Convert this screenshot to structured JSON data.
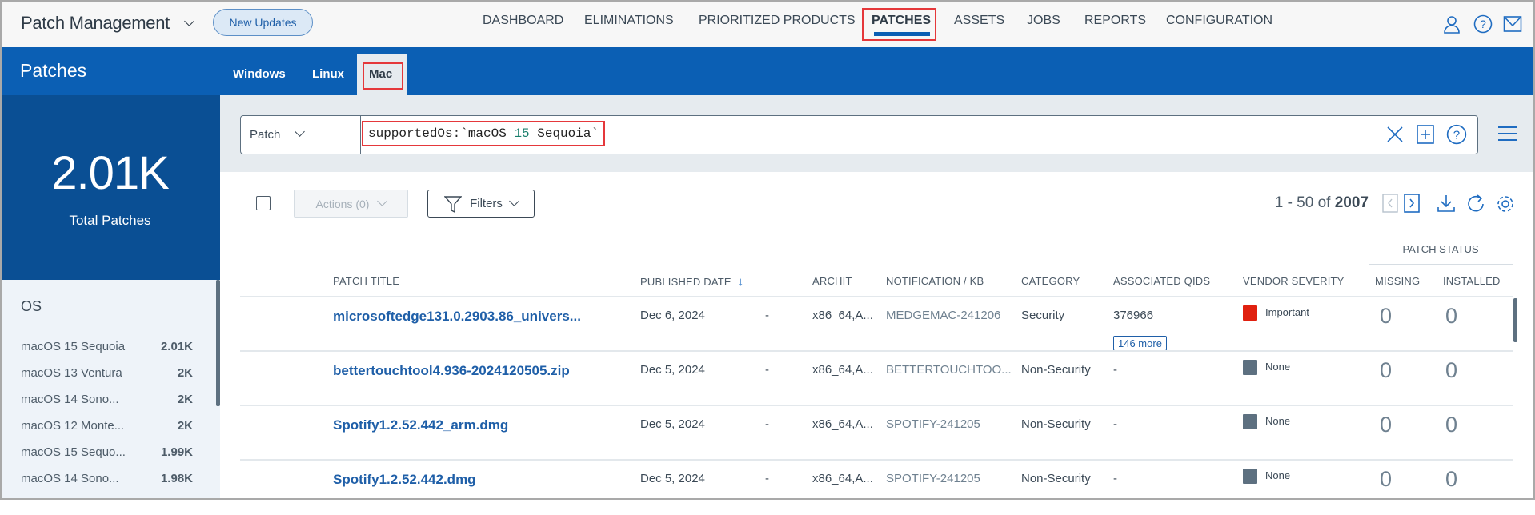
{
  "app": {
    "title": "Patch Management",
    "new_updates": "New Updates"
  },
  "nav": [
    "DASHBOARD",
    "ELIMINATIONS",
    "PRIORITIZED PRODUCTS",
    "PATCHES",
    "ASSETS",
    "JOBS",
    "REPORTS",
    "CONFIGURATION"
  ],
  "nav_active": "PATCHES",
  "header_icons": [
    "user-icon",
    "help-icon",
    "mail-icon"
  ],
  "page": {
    "title": "Patches",
    "tabs": [
      "Windows",
      "Linux",
      "Mac"
    ],
    "active_tab": "Mac"
  },
  "summary": {
    "value": "2.01K",
    "label": "Total Patches"
  },
  "os_filter": {
    "title": "OS",
    "items": [
      {
        "label": "macOS 15 Sequoia",
        "count": "2.01K"
      },
      {
        "label": "macOS 13 Ventura",
        "count": "2K"
      },
      {
        "label": "macOS 14 Sono...",
        "count": "2K"
      },
      {
        "label": "macOS 12 Monte...",
        "count": "2K"
      },
      {
        "label": "macOS 15 Sequo...",
        "count": "1.99K"
      },
      {
        "label": "macOS 14 Sono...",
        "count": "1.98K"
      }
    ]
  },
  "search": {
    "type": "Patch",
    "query_prefix": "supportedOs:`macOS ",
    "query_num": "15",
    "query_suffix": " Sequoia`"
  },
  "toolbar": {
    "actions": "Actions (0)",
    "filters": "Filters",
    "pager_range": "1 - 50 of",
    "pager_total": "2007"
  },
  "table": {
    "group_header": "PATCH STATUS",
    "columns": [
      "PATCH TITLE",
      "PUBLISHED DATE",
      "ARCHIT",
      "NOTIFICATION / KB",
      "CATEGORY",
      "ASSOCIATED QIDS",
      "VENDOR SEVERITY",
      "MISSING",
      "INSTALLED"
    ],
    "sort_indicator": "↓",
    "rows": [
      {
        "title": "microsoftedge131.0.2903.86_univers...",
        "date": "Dec 6, 2024",
        "extra": "-",
        "arch": "x86_64,A...",
        "kb": "MEDGEMAC-241206",
        "category": "Security",
        "qids": "376966",
        "qids_more": "146 more",
        "severity": "Important",
        "severity_color": "#e0200f",
        "missing": "0",
        "installed": "0"
      },
      {
        "title": "bettertouchtool4.936-2024120505.zip",
        "date": "Dec 5, 2024",
        "extra": "-",
        "arch": "x86_64,A...",
        "kb": "BETTERTOUCHTOO...",
        "category": "Non-Security",
        "qids": "-",
        "severity": "None",
        "severity_color": "#5d7080",
        "missing": "0",
        "installed": "0"
      },
      {
        "title": "Spotify1.2.52.442_arm.dmg",
        "date": "Dec 5, 2024",
        "extra": "-",
        "arch": "x86_64,A...",
        "kb": "SPOTIFY-241205",
        "category": "Non-Security",
        "qids": "-",
        "severity": "None",
        "severity_color": "#5d7080",
        "missing": "0",
        "installed": "0"
      },
      {
        "title": "Spotify1.2.52.442.dmg",
        "date": "Dec 5, 2024",
        "extra": "-",
        "arch": "x86_64,A...",
        "kb": "SPOTIFY-241205",
        "category": "Non-Security",
        "qids": "-",
        "severity": "None",
        "severity_color": "#5d7080",
        "missing": "0",
        "installed": "0"
      }
    ]
  },
  "colors": {
    "brand_blue": "#0b5fb4",
    "sidebar_dark": "#0a4f94",
    "highlight_red": "#e5383b"
  }
}
